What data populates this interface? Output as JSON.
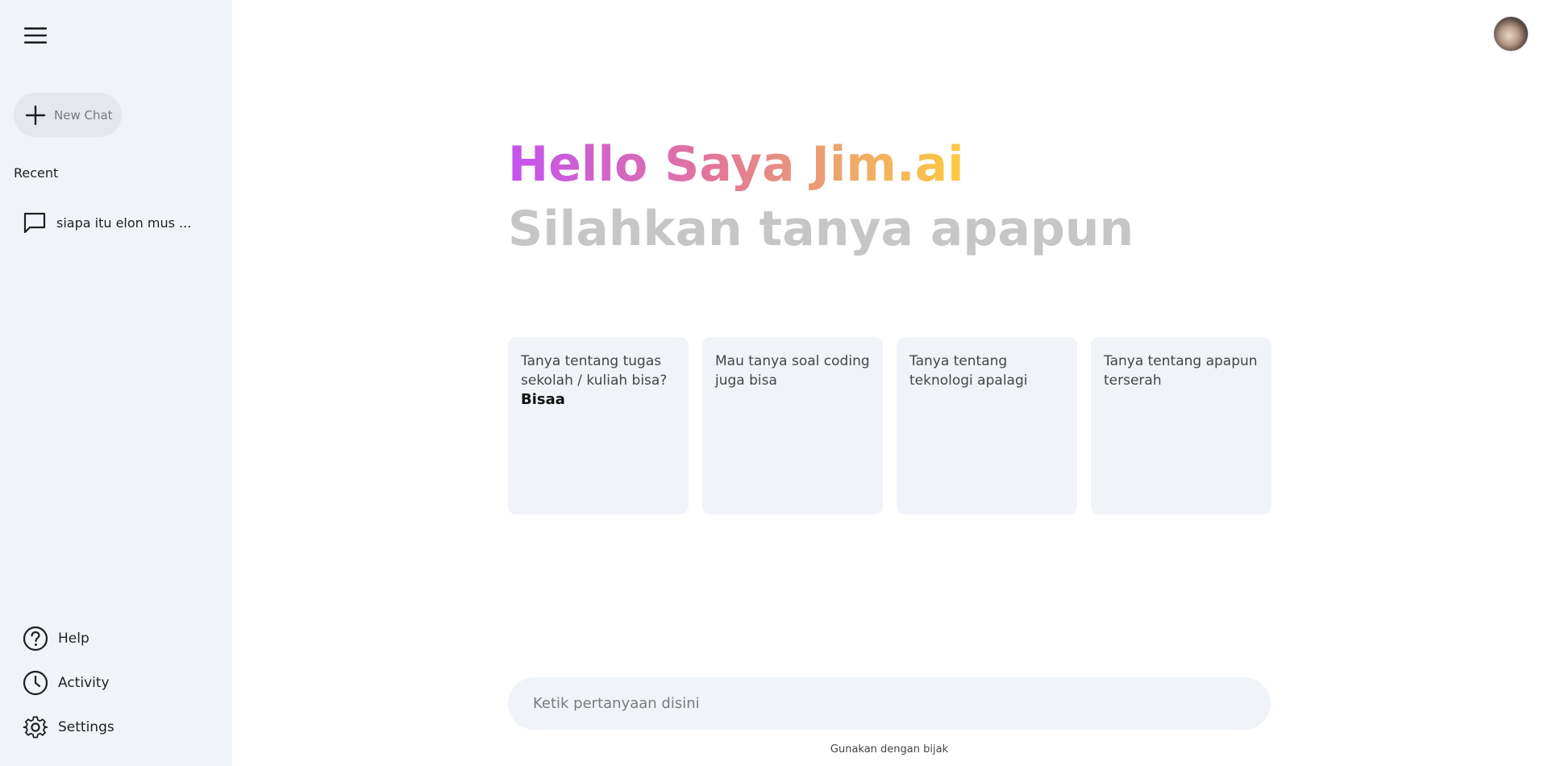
{
  "sidebar": {
    "new_chat_label": "New Chat",
    "recent_title": "Recent",
    "recent_items": [
      {
        "label": "siapa itu elon mus ..."
      }
    ],
    "bottom_items": [
      {
        "label": "Help",
        "icon": "help-icon"
      },
      {
        "label": "Activity",
        "icon": "activity-icon"
      },
      {
        "label": "Settings",
        "icon": "settings-icon"
      }
    ]
  },
  "main": {
    "greeting": "Hello Saya Jim.ai",
    "subtitle": "Silahkan tanya apapun",
    "cards": [
      {
        "text": "Tanya tentang tugas sekolah / kuliah bisa?",
        "bold": "Bisaa"
      },
      {
        "text": "Mau tanya soal coding juga bisa"
      },
      {
        "text": "Tanya tentang teknologi apalagi"
      },
      {
        "text": "Tanya tentang apapun terserah"
      }
    ],
    "input_placeholder": "Ketik pertanyaan disini",
    "footer_note": "Gunakan dengan bijak"
  },
  "colors": {
    "sidebar_bg": "#f0f4f9",
    "greeting_gradient": [
      "#c453f0",
      "#e2769a",
      "#f0b060",
      "#ffc940"
    ],
    "subtitle": "#c4c7c5"
  }
}
